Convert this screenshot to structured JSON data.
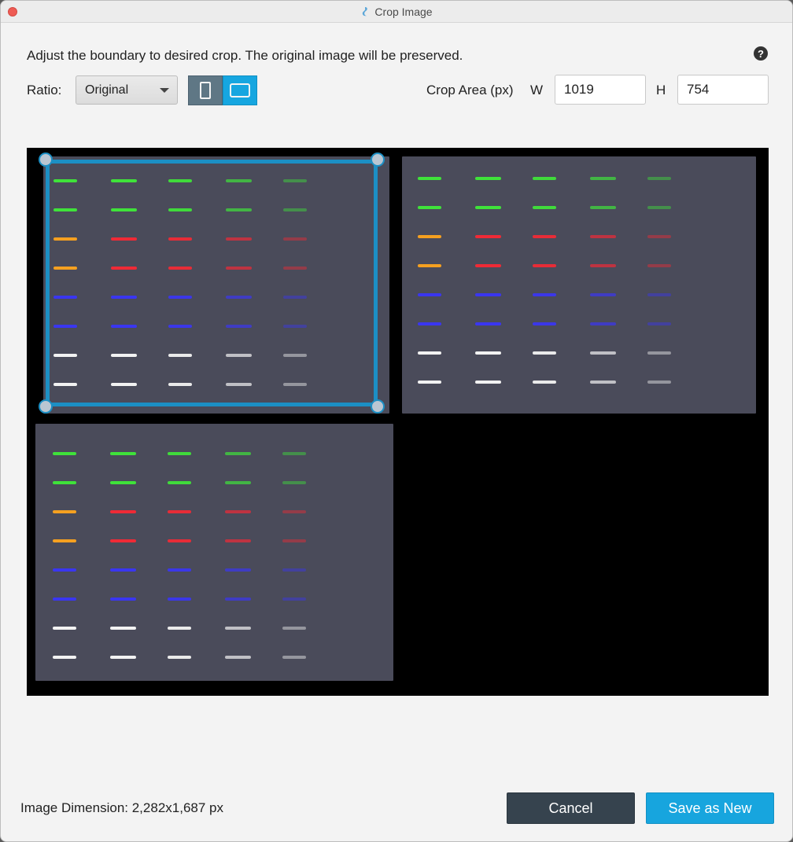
{
  "window": {
    "title": "Crop Image"
  },
  "instructions": "Adjust the boundary to desired crop. The original image will be preserved.",
  "help_icon": "?",
  "ratio": {
    "label": "Ratio:",
    "selected": "Original"
  },
  "crop_area": {
    "label": "Crop Area (px)",
    "w_label": "W",
    "w_value": "1019",
    "h_label": "H",
    "h_value": "754"
  },
  "footer": {
    "dimension": "Image Dimension: 2,282x1,687 px"
  },
  "buttons": {
    "cancel": "Cancel",
    "save": "Save as New"
  },
  "colors": {
    "accent": "#17a5de",
    "crop_border": "#1c8fc4",
    "cancel_bg": "#36434e",
    "close_dot": "#ee5b54",
    "spot_green": "#3fe23a",
    "spot_red": "#ef2a36",
    "spot_orange": "#f5a020",
    "spot_blue": "#3a36f0",
    "spot_white": "#f2f2f2",
    "membrane": "#4a4b5a"
  },
  "icons": {
    "close": "close-dot-icon",
    "app": "app-logo-icon",
    "help": "help-icon",
    "dropdown": "chevron-down-icon",
    "portrait": "portrait-orientation-icon",
    "landscape": "landscape-orientation-icon"
  }
}
